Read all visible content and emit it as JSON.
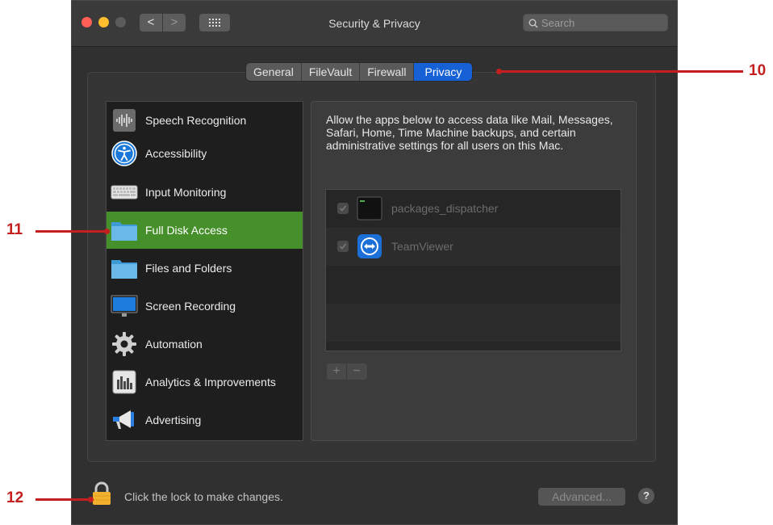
{
  "window": {
    "title": "Security & Privacy",
    "search_placeholder": "Search",
    "nav_back": "<",
    "nav_forward": ">"
  },
  "tabs": [
    {
      "label": "General",
      "active": false
    },
    {
      "label": "FileVault",
      "active": false
    },
    {
      "label": "Firewall",
      "active": false
    },
    {
      "label": "Privacy",
      "active": true
    }
  ],
  "sidebar": {
    "items": [
      {
        "label": "Speech Recognition",
        "icon": "waveform-icon"
      },
      {
        "label": "Accessibility",
        "icon": "accessibility-icon"
      },
      {
        "label": "Input Monitoring",
        "icon": "keyboard-icon"
      },
      {
        "label": "Full Disk Access",
        "icon": "folder-icon",
        "selected": true
      },
      {
        "label": "Files and Folders",
        "icon": "folder-icon"
      },
      {
        "label": "Screen Recording",
        "icon": "display-icon"
      },
      {
        "label": "Automation",
        "icon": "gear-icon"
      },
      {
        "label": "Analytics & Improvements",
        "icon": "bar-chart-icon"
      },
      {
        "label": "Advertising",
        "icon": "megaphone-icon"
      }
    ]
  },
  "main": {
    "description": "Allow the apps below to access data like Mail, Messages, Safari, Home, Time Machine backups, and certain administrative settings for all users on this Mac.",
    "apps": [
      {
        "name": "packages_dispatcher",
        "checked": true,
        "icon": "terminal-icon"
      },
      {
        "name": "TeamViewer",
        "checked": true,
        "icon": "teamviewer-icon"
      }
    ],
    "add_label": "+",
    "remove_label": "−"
  },
  "footer": {
    "lock_text": "Click the lock to make changes.",
    "advanced_label": "Advanced...",
    "help_label": "?"
  },
  "callouts": {
    "c10": "10",
    "c11": "11",
    "c12": "12"
  },
  "colors": {
    "selected_row": "#45902a",
    "active_tab": "#1561d5",
    "callout": "#c41e1e"
  }
}
